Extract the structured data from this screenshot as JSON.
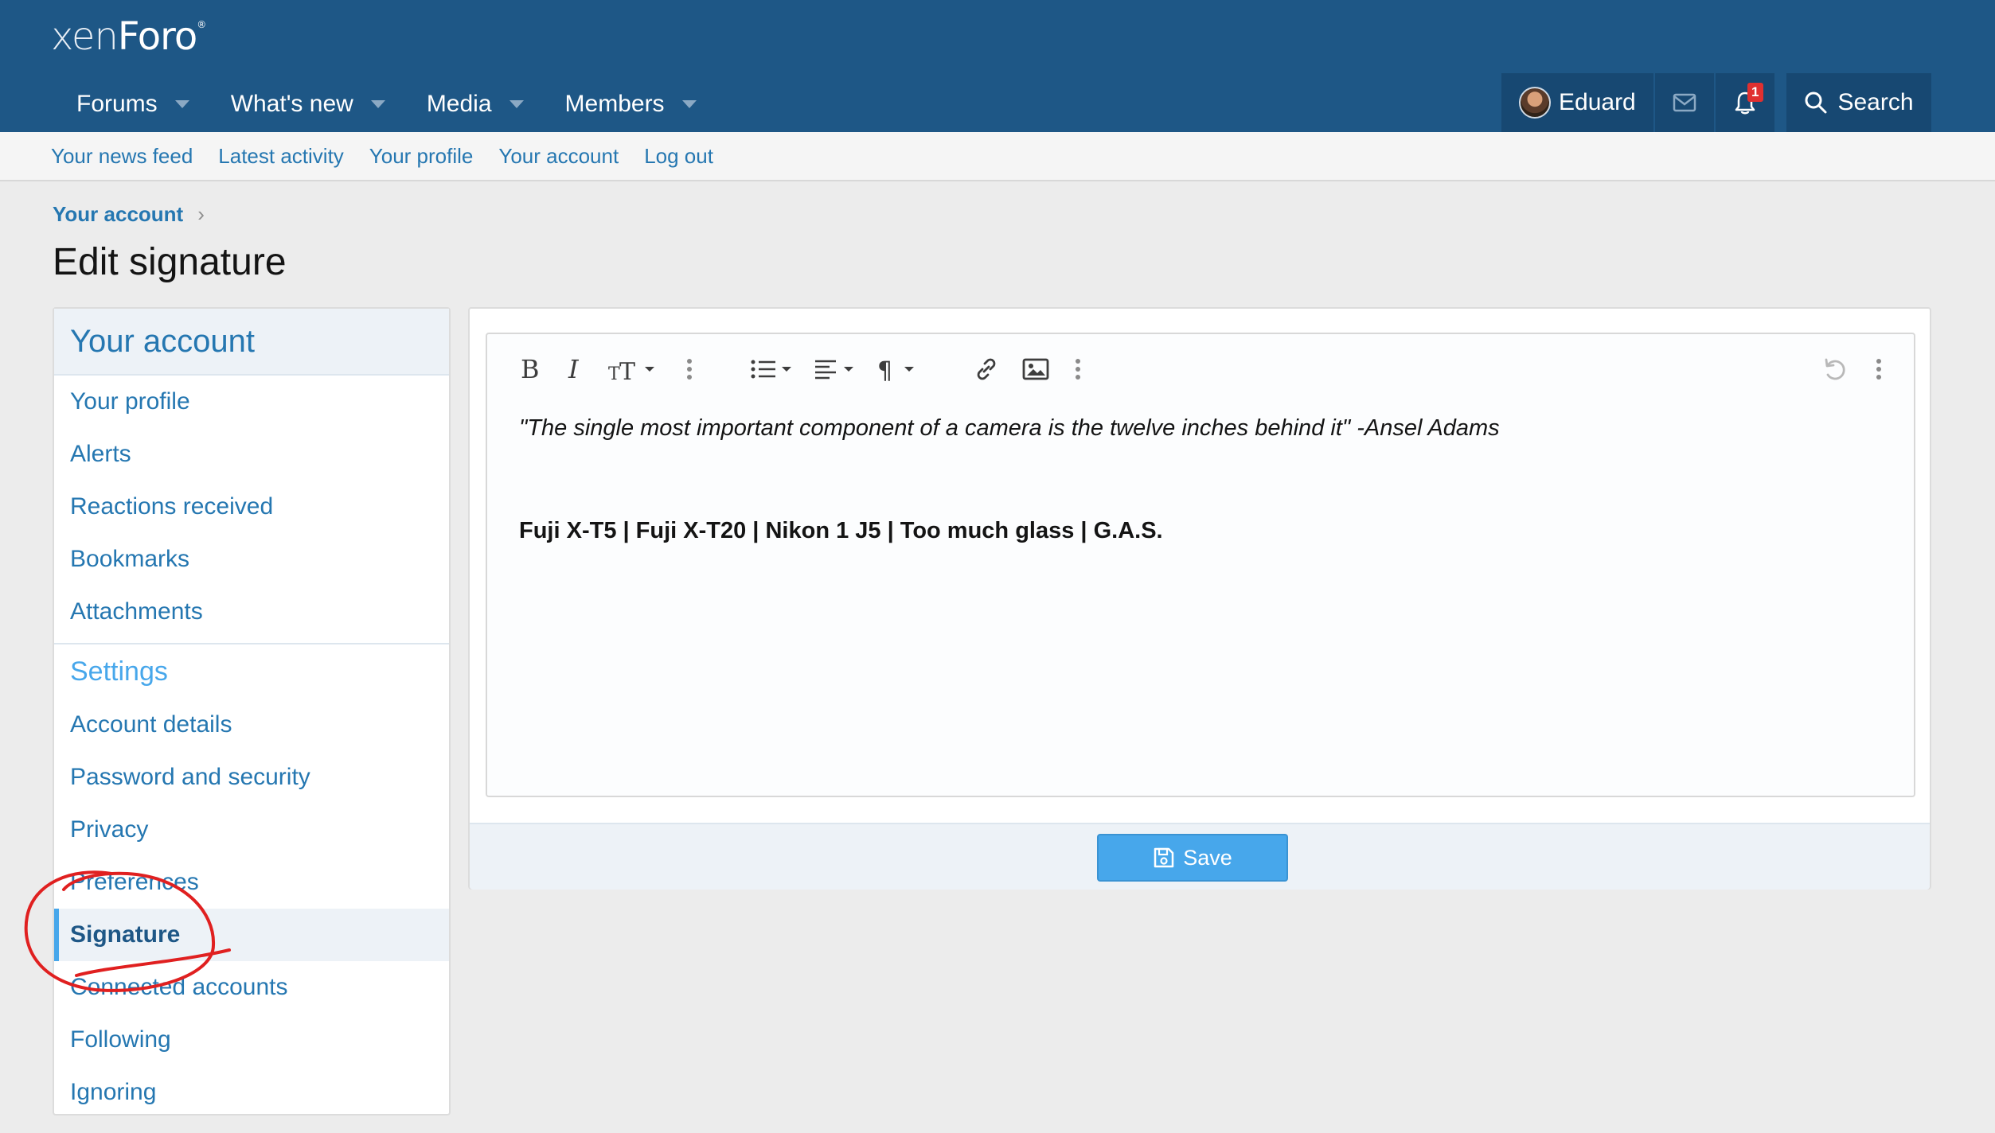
{
  "logo": {
    "part1": "xen",
    "part2": "Foro",
    "mark": "®"
  },
  "nav": {
    "tabs": [
      {
        "label": "Forums"
      },
      {
        "label": "What's new"
      },
      {
        "label": "Media"
      },
      {
        "label": "Members"
      }
    ]
  },
  "user": {
    "name": "Eduard",
    "alerts_count": "1",
    "search_label": "Search"
  },
  "subnav": {
    "links": [
      "Your news feed",
      "Latest activity",
      "Your profile",
      "Your account",
      "Log out"
    ]
  },
  "breadcrumb": {
    "label": "Your account",
    "sep": "›"
  },
  "page": {
    "title": "Edit signature"
  },
  "sidebar": {
    "heading": "Your account",
    "account_items": [
      "Your profile",
      "Alerts",
      "Reactions received",
      "Bookmarks",
      "Attachments"
    ],
    "settings_heading": "Settings",
    "settings_items": [
      "Account details",
      "Password and security",
      "Privacy",
      "Preferences",
      "Signature",
      "Connected accounts",
      "Following",
      "Ignoring"
    ],
    "active_item": "Signature"
  },
  "editor": {
    "quote": "\"The single most important component of a camera is the twelve inches behind it\" -Ansel Adams",
    "gear": "Fuji X-T5 | Fuji X-T20 | Nikon 1 J5 | Too much glass | G.A.S."
  },
  "actions": {
    "save_label": "Save"
  },
  "colors": {
    "header": "#1e5786",
    "link": "#2577b1",
    "accent": "#47a7eb",
    "annotation": "#e02020",
    "badge": "#e03030"
  }
}
